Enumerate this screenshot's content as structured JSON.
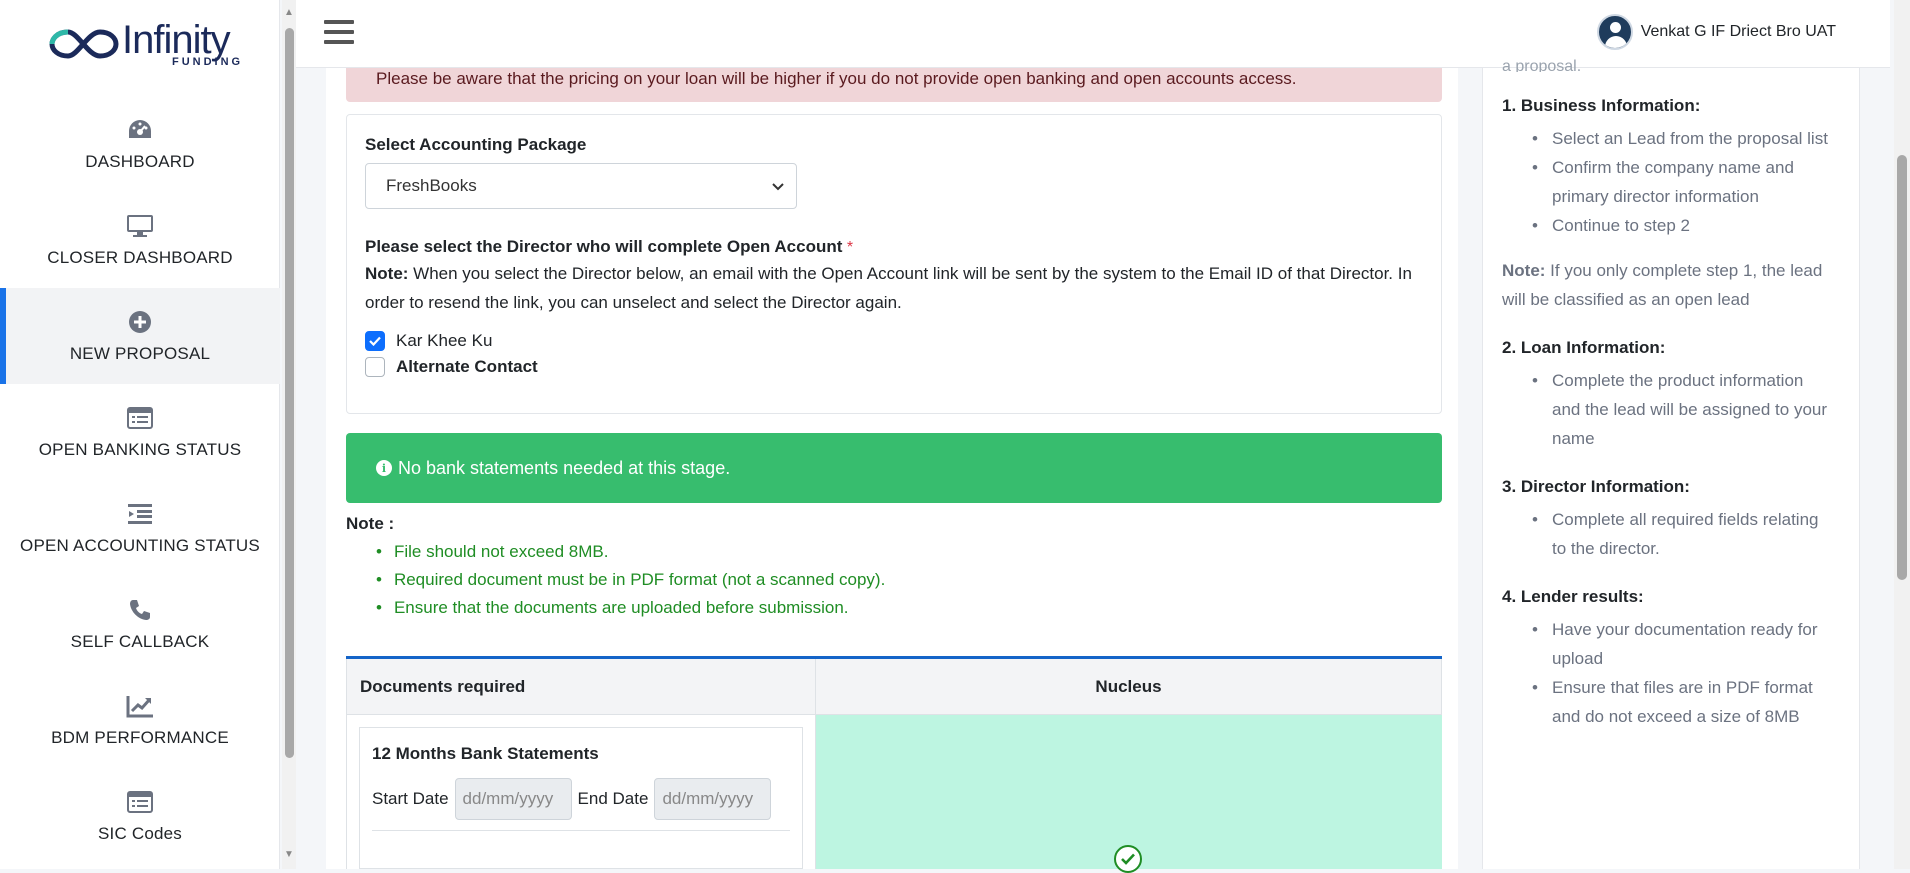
{
  "brand": {
    "name": "Infinity",
    "sub": "FUNDING"
  },
  "sidebar": {
    "items": [
      {
        "label": "DASHBOARD",
        "icon": "dashboard-icon"
      },
      {
        "label": "CLOSER DASHBOARD",
        "icon": "monitor-icon"
      },
      {
        "label": "NEW PROPOSAL",
        "icon": "plus-circle-icon",
        "active": true
      },
      {
        "label": "OPEN BANKING STATUS",
        "icon": "list-card-icon"
      },
      {
        "label": "OPEN ACCOUNTING STATUS",
        "icon": "indent-list-icon"
      },
      {
        "label": "SELF CALLBACK",
        "icon": "phone-icon"
      },
      {
        "label": "BDM PERFORMANCE",
        "icon": "chart-line-icon"
      },
      {
        "label": "SIC Codes",
        "icon": "list-card-icon"
      }
    ]
  },
  "header": {
    "user_name": "Venkat G IF Driect Bro UAT"
  },
  "main": {
    "pricing_alert": "Please be aware that the pricing on your loan will be higher if you do not provide open banking and open accounts access.",
    "accounting": {
      "label": "Select Accounting Package",
      "selected": "FreshBooks"
    },
    "director": {
      "label": "Please select the Director who will complete Open Account",
      "required": "*",
      "note_label": "Note:",
      "note_text": " When you select the Director below, an email with the Open Account link will be sent by the system to the Email ID of that Director. In order to resend the link, you can unselect and select the Director again.",
      "options": [
        {
          "label": "Kar Khee Ku",
          "checked": true
        },
        {
          "label": "Alternate Contact",
          "checked": false
        }
      ]
    },
    "bank_alert": "No bank statements needed at this stage.",
    "notes": {
      "title": "Note :",
      "items": [
        "File should not exceed 8MB.",
        "Required document must be in PDF format (not a scanned copy).",
        "Ensure that the documents are uploaded before submission."
      ]
    },
    "docs_table": {
      "col1": "Documents required",
      "col2": "Nucleus",
      "doc_title": "12 Months Bank Statements",
      "start_label": "Start Date",
      "end_label": "End Date",
      "date_placeholder": "dd/mm/yyyy"
    }
  },
  "help": {
    "cut_text": "a proposal.",
    "sections": [
      {
        "title": "1. Business Information:",
        "items": [
          "Select an Lead from the proposal list",
          "Confirm the company name and primary director information",
          "Continue to step 2"
        ]
      },
      {
        "title": "2. Loan Information:",
        "items": [
          "Complete the product information and the lead will be assigned to your name"
        ]
      },
      {
        "title": "3. Director Information:",
        "items": [
          "Complete all required fields relating to the director."
        ]
      },
      {
        "title": "4. Lender results:",
        "items": [
          "Have your documentation ready for upload",
          "Ensure that files are in PDF format and do not exceed a size of 8MB"
        ]
      }
    ],
    "note_label": "Note:",
    "note_text": " If you only complete step 1, the lead will be classified as an open lead"
  },
  "colors": {
    "accent": "#1a73e8",
    "success": "#37bd6e",
    "danger_bg": "#f0d5d8",
    "brand": "#1b2a5a"
  }
}
